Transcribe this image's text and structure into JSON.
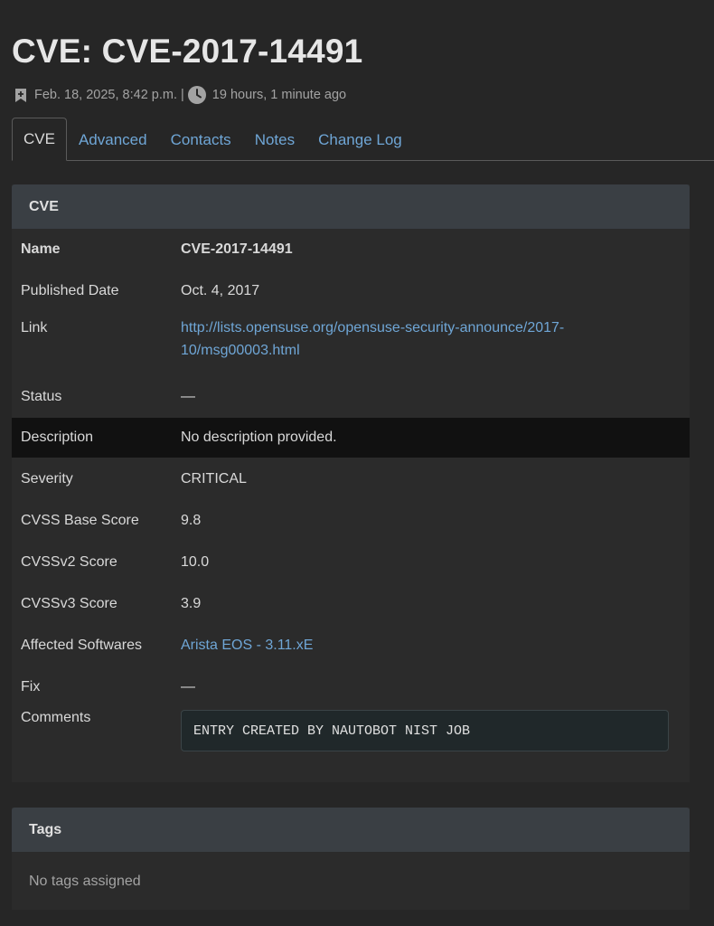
{
  "page": {
    "title": "CVE: CVE-2017-14491",
    "created": "Feb. 18, 2025, 8:42 p.m.",
    "separator": "|",
    "updated": "19 hours, 1 minute ago"
  },
  "tabs": [
    {
      "label": "CVE",
      "active": true
    },
    {
      "label": "Advanced",
      "active": false
    },
    {
      "label": "Contacts",
      "active": false
    },
    {
      "label": "Notes",
      "active": false
    },
    {
      "label": "Change Log",
      "active": false
    }
  ],
  "cve_panel": {
    "heading": "CVE",
    "rows": {
      "name": {
        "label": "Name",
        "value": "CVE-2017-14491"
      },
      "published": {
        "label": "Published Date",
        "value": "Oct. 4, 2017"
      },
      "link": {
        "label": "Link",
        "line1": "http://lists.opensuse.org/opensuse-security-announce/2017-",
        "line2": "10/msg00003.html"
      },
      "status": {
        "label": "Status",
        "value": "—"
      },
      "description": {
        "label": "Description",
        "value": "No description provided."
      },
      "severity": {
        "label": "Severity",
        "value": "CRITICAL"
      },
      "cvss_base": {
        "label": "CVSS Base Score",
        "value": "9.8"
      },
      "cvssv2": {
        "label": "CVSSv2 Score",
        "value": "10.0"
      },
      "cvssv3": {
        "label": "CVSSv3 Score",
        "value": "3.9"
      },
      "affected": {
        "label": "Affected Softwares",
        "value": "Arista EOS - 3.11.xE"
      },
      "fix": {
        "label": "Fix",
        "value": "—"
      },
      "comments": {
        "label": "Comments",
        "value": "ENTRY CREATED BY NAUTOBOT NIST JOB"
      }
    }
  },
  "tags_panel": {
    "heading": "Tags",
    "empty_text": "No tags assigned"
  },
  "colors": {
    "background": "#262626",
    "panel_header": "#3a3f44",
    "link": "#6fa6d6",
    "highlight_row": "#111111"
  },
  "icons": {
    "created": "bookmark-icon",
    "updated": "clock-icon"
  }
}
